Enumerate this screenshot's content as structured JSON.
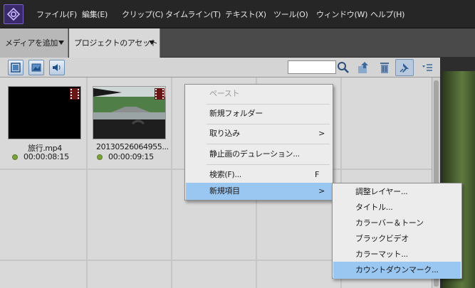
{
  "menubar": {
    "app_icon": "premiere-elements-icon",
    "items": [
      {
        "label": "ファイル(F)"
      },
      {
        "label": "編集(E)"
      },
      {
        "label": "クリップ(C)"
      },
      {
        "label": "タイムライン(T)"
      },
      {
        "label": "テキスト(X)"
      },
      {
        "label": "ツール(O)"
      },
      {
        "label": "ウィンドウ(W)"
      },
      {
        "label": "ヘルプ(H)"
      }
    ]
  },
  "tabs": {
    "add_media": "メディアを追加",
    "project_assets": "プロジェクトのアセット"
  },
  "toolbar": {
    "search_value": "",
    "icons": [
      "video-filter-icon",
      "image-filter-icon",
      "audio-filter-icon",
      "search-icon",
      "move-up-icon",
      "trash-icon",
      "pin-icon",
      "view-options-icon"
    ]
  },
  "clips": [
    {
      "name": "旅行.mp4",
      "duration": "00:00:08:15"
    },
    {
      "name": "20130526064955...",
      "duration": "00:00:09:15"
    }
  ],
  "context_menu": {
    "items": [
      {
        "label": "ペースト",
        "disabled": true
      },
      {
        "label": "新規フォルダー"
      },
      {
        "label": "取り込み",
        "submenu": ">"
      },
      {
        "label": "静止画のデュレーション..."
      },
      {
        "label": "検索(F)...",
        "shortcut": "F"
      },
      {
        "label": "新規項目",
        "submenu": ">",
        "active": true
      }
    ]
  },
  "submenu": {
    "items": [
      {
        "label": "調整レイヤー..."
      },
      {
        "label": "タイトル..."
      },
      {
        "label": "カラーバー＆トーン"
      },
      {
        "label": "ブラックビデオ"
      },
      {
        "label": "カラーマット..."
      },
      {
        "label": "カウントダウンマーク...",
        "active": true
      }
    ]
  },
  "colors": {
    "menu_highlight": "#9ac6f2",
    "status_dot": "#7aa23a"
  }
}
